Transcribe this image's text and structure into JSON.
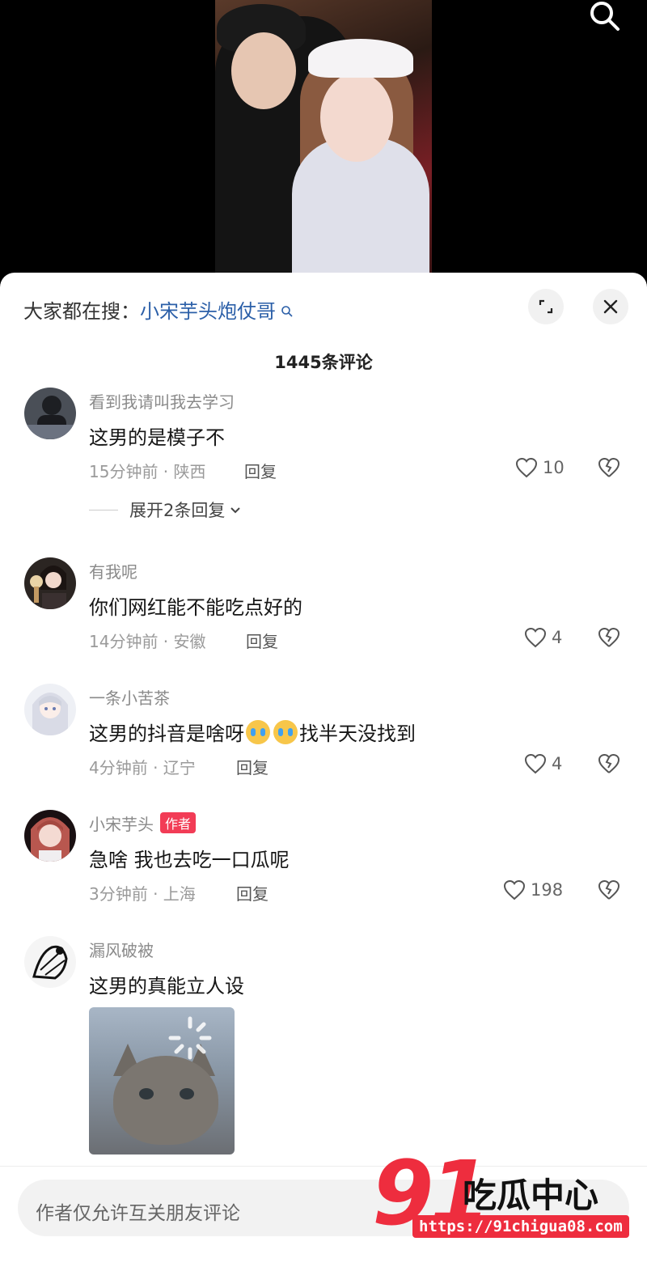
{
  "search_suggestion": {
    "prefix": "大家都在搜：",
    "keyword": "小宋芋头炮仗哥"
  },
  "comment_count": "1445条评论",
  "comments": [
    {
      "username": "看到我请叫我去学习",
      "text": "这男的是模子不",
      "meta": "15分钟前 · 陕西",
      "reply": "回复",
      "likes": "10",
      "expand": "展开2条回复"
    },
    {
      "username": "有我呢",
      "text": "你们网红能不能吃点好的",
      "meta": "14分钟前 · 安徽",
      "reply": "回复",
      "likes": "4"
    },
    {
      "username": "一条小苦茶",
      "text_before": "这男的抖音是啥呀",
      "text_after": "找半天没找到",
      "emoji": "crying-emoji",
      "meta": "4分钟前 · 辽宁",
      "reply": "回复",
      "likes": "4"
    },
    {
      "username": "小宋芋头",
      "tag": "作者",
      "text": "急啥 我也去吃一口瓜呢",
      "meta": "3分钟前 · 上海",
      "reply": "回复",
      "likes": "198"
    },
    {
      "username": "漏风破被",
      "text": "这男的真能立人设",
      "image": "crying-cat-sticker"
    }
  ],
  "input_placeholder": "作者仅允许互关朋友评论",
  "watermark": {
    "number": "91",
    "text": "吃瓜中心",
    "url": "https://91chigua08.com"
  },
  "colors": {
    "accent_link": "#2b5fa8",
    "author_tag": "#f23c56",
    "watermark_red": "#ee2d3e"
  }
}
